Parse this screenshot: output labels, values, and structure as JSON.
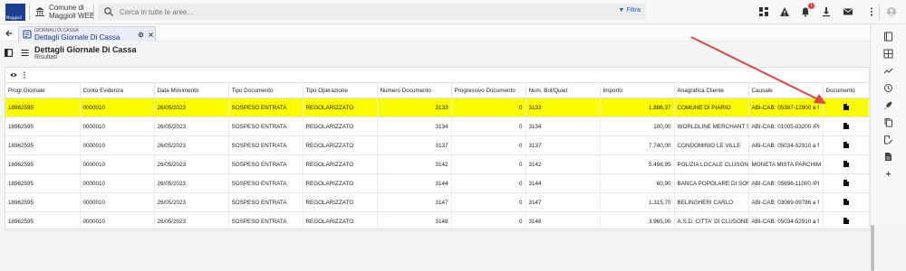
{
  "app": {
    "logo_text": "Maggioli",
    "title_line1": "Comune di",
    "title_line2": "Maggioli WEB"
  },
  "search": {
    "placeholder": "Cerca in tutte le aree...",
    "filter_label": "Filtra"
  },
  "topbar": {
    "notification_count": "1"
  },
  "tab": {
    "module": "GIORNALI DI CASSA",
    "title": "Dettagli Giornale Di Cassa"
  },
  "header": {
    "title": "Dettagli Giornale Di Cassa",
    "subtitle": "Risultati"
  },
  "table": {
    "columns": [
      "Progr.Giornale",
      "Conto Evidenza",
      "Data Movimento",
      "Tipo Documento",
      "Tipo Operazione",
      "Numero Documento",
      "Progressivo Documento",
      "Num. Bol/Quiet",
      "Importo",
      "Anagrafica Cliente",
      "Causale",
      "Documento"
    ],
    "rows": [
      [
        "18962595",
        "0000010",
        "26/05/2023",
        "SOSPESO ENTRATA",
        "REGOLARIZZATO",
        "3133",
        "0",
        "3133",
        "1.886,37",
        "COMUNE DI PIARIO",
        "ABI-CAB: 05387-12900 a f"
      ],
      [
        "18962595",
        "0000010",
        "26/05/2023",
        "SOSPESO ENTRATA",
        "REGOLARIZZATO",
        "3134",
        "0",
        "3134",
        "100,00",
        "WORLDLINE MERCHANT S",
        "ABI-CAB: 01005-03200 /PI"
      ],
      [
        "18962595",
        "0000010",
        "26/05/2023",
        "SOSPESO ENTRATA",
        "REGOLARIZZATO",
        "3137",
        "0",
        "3137",
        "7.740,00",
        "CONDOMINIO LE VILLE",
        "ABI-CAB: 05034-52910 a f"
      ],
      [
        "18962595",
        "0000010",
        "26/05/2023",
        "SOSPESO ENTRATA",
        "REGOLARIZZATO",
        "3142",
        "0",
        "3142",
        "5.498,95",
        "POLIZIA LOCALE CLUSONI",
        "MONETA MISTA PARCHIM"
      ],
      [
        "18962595",
        "0000010",
        "26/05/2023",
        "SOSPESO ENTRATA",
        "REGOLARIZZATO",
        "3144",
        "0",
        "3144",
        "60,90",
        "BANCA POPOLARE DI SON",
        "ABI-CAB: 05696-11000 /PI"
      ],
      [
        "18962595",
        "0000010",
        "26/05/2023",
        "SOSPESO ENTRATA",
        "REGOLARIZZATO",
        "3147",
        "0",
        "3147",
        "1.315,70",
        "BELINGHERI CARLO",
        "ABI-CAB: 03069-09786 a f"
      ],
      [
        "18962595",
        "0000010",
        "26/05/2023",
        "SOSPESO ENTRATA",
        "REGOLARIZZATO",
        "3148",
        "0",
        "3148",
        "3.965,00",
        "A.S.D. CITTA' DI CLUSONE",
        "ABI-CAB: 05034-52910 a f"
      ]
    ]
  },
  "colors": {
    "highlight": "#fbfb00",
    "brand": "#1c3f8f",
    "annotation_arrow": "#d94a3d"
  }
}
